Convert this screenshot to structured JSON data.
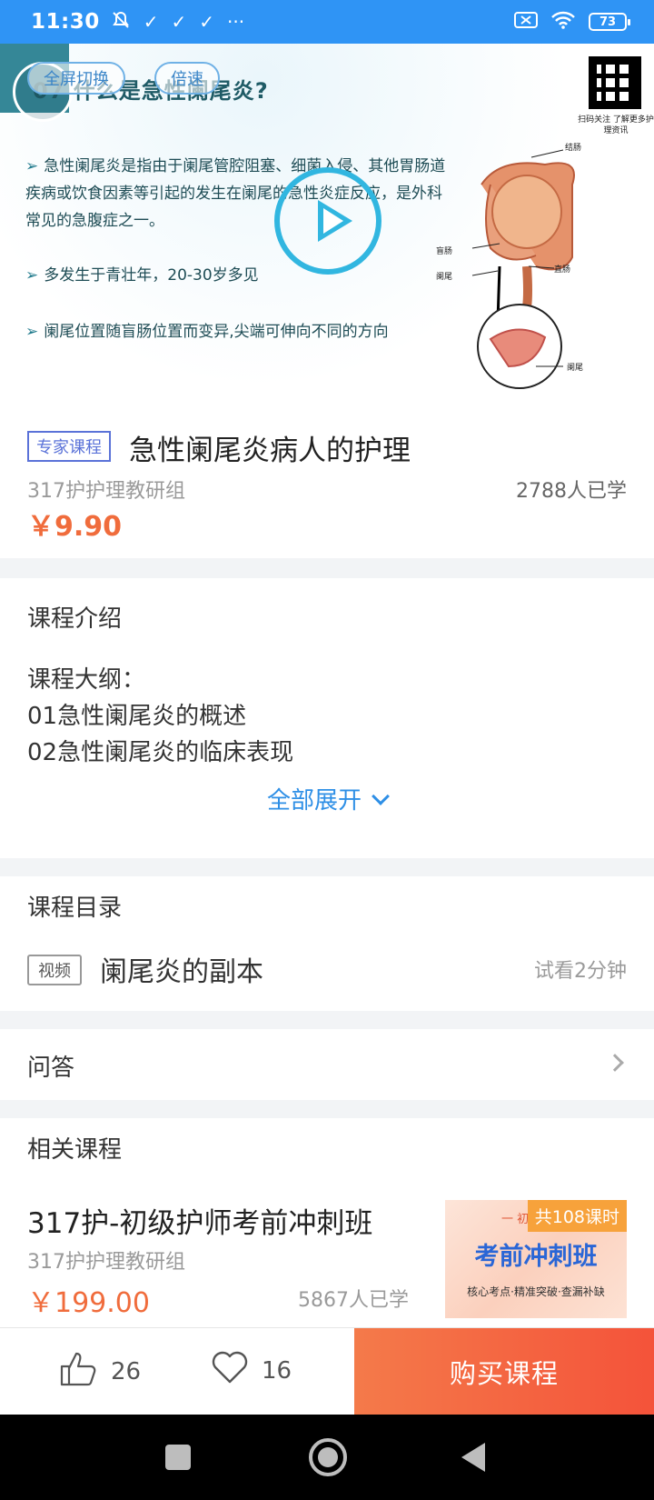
{
  "status_bar": {
    "time": "11:30",
    "battery": "73",
    "left_glyphs": [
      "✓",
      "✓",
      "✓",
      "···"
    ]
  },
  "video": {
    "fullscreen_label": "全屏切换",
    "speed_label": "倍速",
    "slide_title": "07 什么是急性阑尾炎?",
    "bullets": [
      "急性阑尾炎是指由于阑尾管腔阻塞、细菌入侵、其他胃肠道疾病或饮食因素等引起的发生在阑尾的急性炎症反应，是外科常见的急腹症之一。",
      "多发生于青壮年，20-30岁多见",
      "阑尾位置随盲肠位置而变异,尖端可伸向不同的方向"
    ],
    "qr_caption": "扫码关注 了解更多护理资讯",
    "anatomy_labels": {
      "colon": "结肠",
      "cecum": "盲肠",
      "appendix": "阑尾",
      "rectum": "直肠",
      "appendix2": "阑尾"
    }
  },
  "course": {
    "tag": "专家课程",
    "title": "急性阑尾炎病人的护理",
    "org": "317护护理教研组",
    "learners": "2788人已学",
    "price": "￥9.90"
  },
  "intro": {
    "title": "课程介绍",
    "lines": [
      "课程大纲：",
      "01急性阑尾炎的概述",
      "02急性阑尾炎的临床表现"
    ],
    "expand_label": "全部展开"
  },
  "catalog": {
    "title": "课程目录",
    "lesson_tag": "视频",
    "lesson_title": "阑尾炎的副本",
    "trial": "试看2分钟"
  },
  "qa": {
    "title": "问答"
  },
  "related": {
    "title": "相关课程",
    "course_title": "317护-初级护师考前冲刺班",
    "org": "317护护理教研组",
    "price": "￥199.00",
    "learners": "5867人已学",
    "thumb_badge": "共108课时",
    "thumb_sub": "一 初级",
    "thumb_main": "考前冲刺班",
    "thumb_slogan": "核心考点·精准突破·查漏补缺"
  },
  "actions": {
    "likes": "26",
    "favorites": "16",
    "buy_label": "购买课程"
  }
}
